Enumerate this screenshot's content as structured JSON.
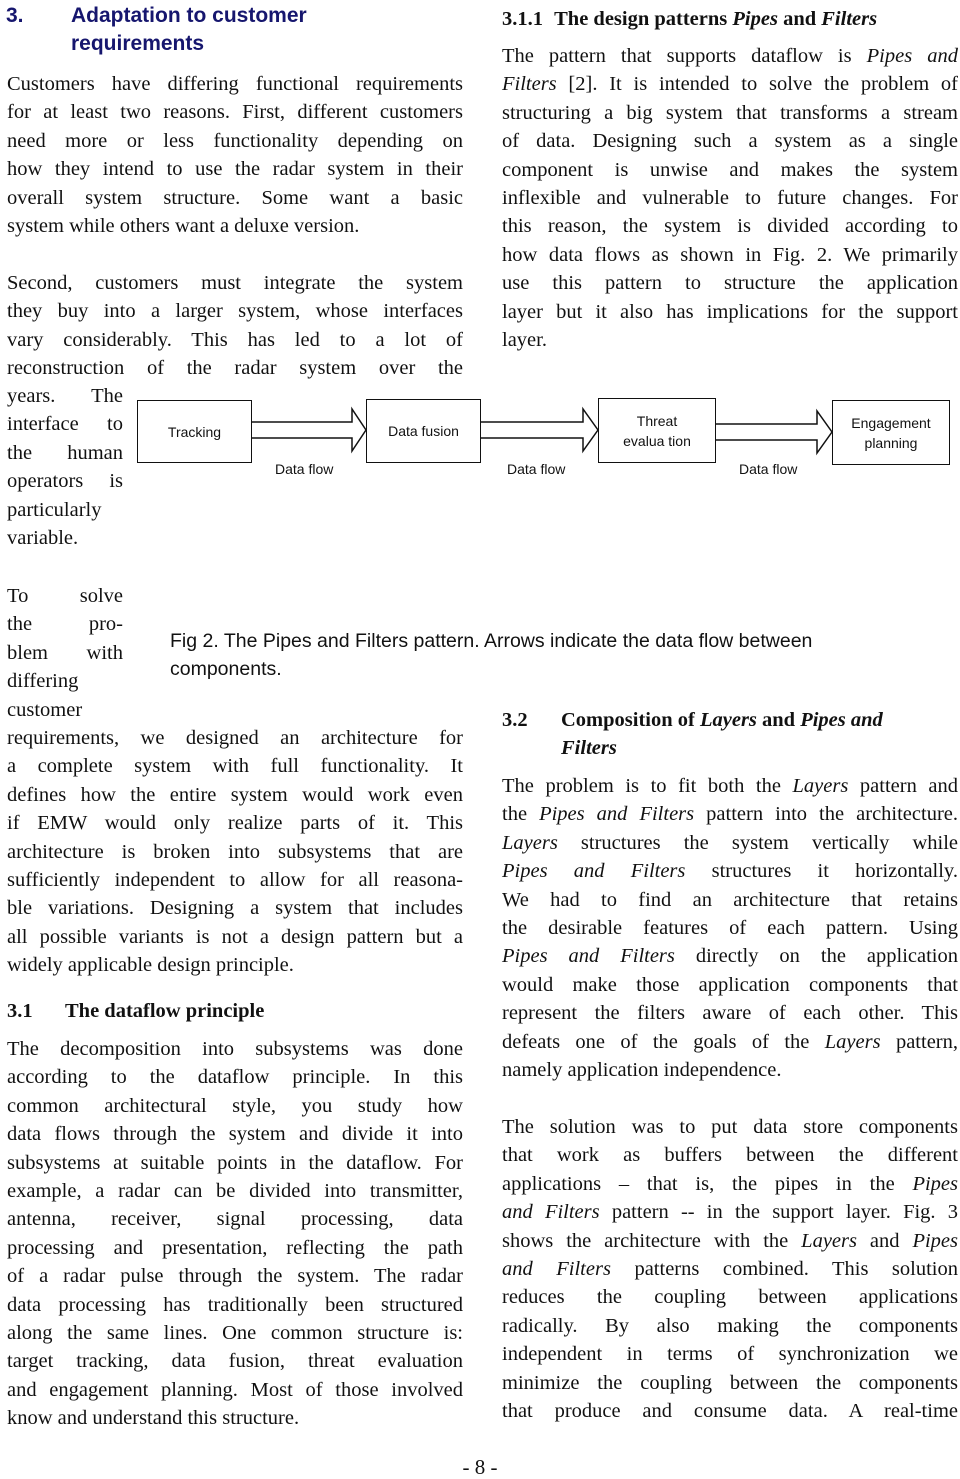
{
  "section3": {
    "number": "3.",
    "title": "Adaptation to customer requirements",
    "title_line1": "Adaptation to customer",
    "title_line2": "requirements"
  },
  "left": {
    "para1": [
      "Customers have differing functional requirements",
      "for at least two reasons. First, different customers",
      "need more or less functionality depending on",
      "how they intend to use the radar system in their",
      "overall system structure.  Some want a basic",
      "system while others want a deluxe version."
    ],
    "para2": [
      "Second, customers must integrate the system",
      "they buy into a larger system, whose interfaces",
      "vary considerably. This has led to a lot of",
      "reconstruction of the radar system over the"
    ],
    "para2_narrow": [
      "years. The",
      "interface to",
      "the human",
      "operators is",
      "particularly",
      "variable."
    ],
    "para3_narrow": [
      "To solve",
      "the pro-",
      "blem with",
      "differing",
      "customer"
    ],
    "para3": [
      "requirements, we designed an architecture for",
      "a complete system with full functionality. It",
      "defines how the entire system would work even",
      "if EMW would only realize parts of it. This",
      "architecture is broken into subsystems that are",
      "sufficiently independent to allow for all reasona-",
      "ble variations. Designing a system that includes",
      "all possible variants is not a design pattern but a",
      "widely applicable design principle."
    ],
    "section31": {
      "number": "3.1",
      "title": "The dataflow principle"
    },
    "para4": [
      "The decomposition into subsystems was done",
      "according to the dataflow principle. In this",
      "common architectural style, you study how",
      "data flows through the system and divide it into",
      "subsystems at suitable points in the dataflow. For",
      "example, a radar can be divided into transmitter,",
      "antenna, receiver, signal processing, data",
      "processing and presentation, reflecting the path",
      "of a radar pulse through the system. The radar",
      "data processing has traditionally been structured",
      "along the same lines. One common structure is:",
      "target tracking, data fusion, threat evaluation",
      "and engagement planning. Most of those involved",
      "know and understand this structure."
    ]
  },
  "right": {
    "section311": {
      "number": "3.1.1",
      "title_a": "The design patterns ",
      "title_b": "Pipes",
      "title_c": " and ",
      "title_d": "Filters"
    },
    "para1": {
      "l1a": "The pattern that supports dataflow is ",
      "l1b": "Pipes and",
      "l2a": "Filters",
      "l2b": " [2]. It is intended to solve the problem of",
      "rest": [
        "structuring a big system that transforms a stream",
        "of data. Designing such a system as a single",
        "component is unwise and makes the system",
        "inflexible and vulnerable to future changes. For",
        "this reason, the system is divided according to",
        "how data flows as shown in Fig. 2. We primarily",
        "use this pattern to structure the application",
        "layer but it also has implications for the support",
        "layer."
      ]
    },
    "section32": {
      "number": "3.2",
      "t1": "Composition of ",
      "t2": "Layers",
      "t3": " and ",
      "t4": "Pipes and",
      "t5": "Filters"
    },
    "para2": {
      "l1a": "The problem is to fit both the ",
      "l1b": "Layers",
      "l1c": " pattern and",
      "l2a": "the ",
      "l2b": "Pipes and Filters",
      "l2c": " pattern into the architecture.",
      "l3a": "Layers",
      "l3b": " structures the system vertically while",
      "l4a": "Pipes and Filters",
      "l4b": " structures it horizontally.",
      "l5": "We had to find an architecture that retains",
      "l6": "the desirable features of each pattern. Using",
      "l7a": "Pipes and Filters",
      "l7b": " directly on the application",
      "l8": "would make those application components that",
      "l9": "represent the filters aware of each other. This",
      "l10a": "defeats one of the goals of the ",
      "l10b": "Layers",
      "l10c": " pattern,",
      "l11": "namely application independence."
    },
    "para3": {
      "l1": "The solution was to put data store components",
      "l2": "that work as buffers between the different",
      "l3a": "applications – that is, the pipes in the ",
      "l3b": "Pipes",
      "l4a": "and Filters",
      "l4b": " pattern -- in the support layer. Fig. 3",
      "l5a": "shows the architecture with the ",
      "l5b": "Layers",
      "l5c": " and ",
      "l5d": "Pipes",
      "l6a": "and Filters",
      "l6b": " patterns combined. This solution",
      "l7": "reduces the coupling between applications",
      "l8": "radically. By also making the components",
      "l9": "independent in terms of synchronization we",
      "l10": "minimize the coupling between the components",
      "l11": "that produce and consume data. A real-time"
    }
  },
  "figure": {
    "components": [
      "Tracking",
      "Data fusion",
      "Threat evalua tion",
      "Engagement planning"
    ],
    "threat_lines": [
      "Threat",
      "evalua tion"
    ],
    "engagement_lines": [
      "Engagement",
      "planning"
    ],
    "flow_labels": [
      "Data flow",
      "Data flow",
      "Data flow"
    ],
    "caption_line1": "Fig 2. The Pipes and Filters pattern. Arrows indicate the data flow between",
    "caption_line2": "components."
  },
  "footer": {
    "page_number": "- 8 -"
  }
}
